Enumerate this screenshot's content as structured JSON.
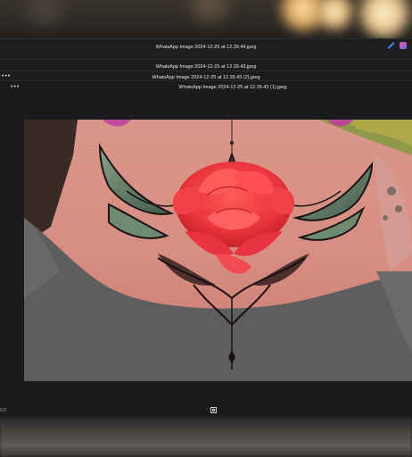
{
  "windows": [
    {
      "title": "WhatsApp Image 2024-12-25 at 12.39.44.jpeg"
    },
    {
      "title": "WhatsApp Image 2024-12-25 at 12.39.43.jpeg"
    },
    {
      "title": "WhatsApp Image 2024-12-25 at 12.39.43 (2).jpeg",
      "menu_glyph": "•••"
    },
    {
      "title": "WhatsApp Image 2024-12-25 at 12.39.43 (1).jpeg",
      "menu_glyph": "•••"
    }
  ],
  "status": {
    "left_text": "5.8"
  },
  "icons": {
    "edit": "edit-icon",
    "app": "app-icon",
    "fit": "fit-to-window-icon"
  },
  "colors": {
    "accent": "#3a8ef0",
    "window_bg": "#1e1e20",
    "rose": "#ee3a3e"
  }
}
